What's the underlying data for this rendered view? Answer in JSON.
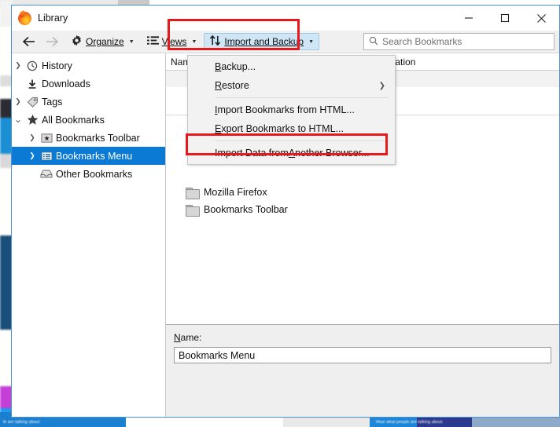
{
  "window": {
    "title": "Library",
    "logo_icon": "firefox-logo-icon",
    "minimize_label": "Minimize",
    "maximize_label": "Maximize",
    "close_label": "Close"
  },
  "toolbar": {
    "back_label": "Back",
    "forward_label": "Forward",
    "organize_label": "Organize",
    "organize_icon": "gear-icon",
    "views_label": "Views",
    "views_icon": "list-view-icon",
    "import_backup_label": "Import and Backup",
    "import_backup_icon": "import-export-arrows-icon",
    "caret_icon": "chevron-down-icon",
    "highlight_color": "#e8191b",
    "active_button_bg": "#cfe6f7"
  },
  "search": {
    "placeholder": "Search Bookmarks",
    "value": "",
    "icon": "search-icon"
  },
  "menu": {
    "items": [
      {
        "label": "Backup...",
        "type": "item",
        "submenu": false,
        "icon": ""
      },
      {
        "label": "Restore",
        "type": "item",
        "submenu": true,
        "icon": "chevron-right-icon"
      },
      {
        "label": "",
        "type": "separator",
        "submenu": false,
        "icon": ""
      },
      {
        "label": "Import Bookmarks from HTML...",
        "type": "item",
        "submenu": false,
        "icon": ""
      },
      {
        "label": "Export Bookmarks to HTML...",
        "type": "item",
        "submenu": false,
        "icon": ""
      },
      {
        "label": "",
        "type": "separator",
        "submenu": false,
        "icon": ""
      },
      {
        "label": "Import Data from Another Browser...",
        "type": "item",
        "submenu": false,
        "icon": ""
      }
    ],
    "submenu_glyph": "›"
  },
  "sidebar": {
    "items": [
      {
        "label": "History",
        "icon": "clock-icon",
        "twisty": "collapsed",
        "indent": 0,
        "selected": false
      },
      {
        "label": "Downloads",
        "icon": "download-icon",
        "twisty": "none",
        "indent": 0,
        "selected": false
      },
      {
        "label": "Tags",
        "icon": "tag-icon",
        "twisty": "collapsed",
        "indent": 0,
        "selected": false
      },
      {
        "label": "All Bookmarks",
        "icon": "star-icon",
        "twisty": "expanded",
        "indent": 0,
        "selected": false
      },
      {
        "label": "Bookmarks Toolbar",
        "icon": "bookmarks-toolbar-icon",
        "twisty": "collapsed",
        "indent": 1,
        "selected": false
      },
      {
        "label": "Bookmarks Menu",
        "icon": "bookmarks-menu-icon",
        "twisty": "collapsed",
        "indent": 1,
        "selected": true
      },
      {
        "label": "Other Bookmarks",
        "icon": "tray-icon",
        "twisty": "none",
        "indent": 1,
        "selected": false
      }
    ],
    "selection_color": "#0a7ad4",
    "collapsed_glyph": "›",
    "expanded_glyph": "⌄"
  },
  "list": {
    "columns": [
      {
        "label": "Name"
      },
      {
        "label": "Location"
      }
    ],
    "rows": [
      {
        "name": "Mozilla Firefox",
        "location": "",
        "icon": "folder-icon"
      },
      {
        "name": "Bookmarks Toolbar",
        "location": "",
        "icon": "folder-icon"
      }
    ]
  },
  "details": {
    "name_label": "Name:",
    "name_value": "Bookmarks Menu"
  },
  "backdrop": {
    "strip_text_left": "le are talking about.",
    "strip_text_mid": "Hear what people are talking about."
  }
}
